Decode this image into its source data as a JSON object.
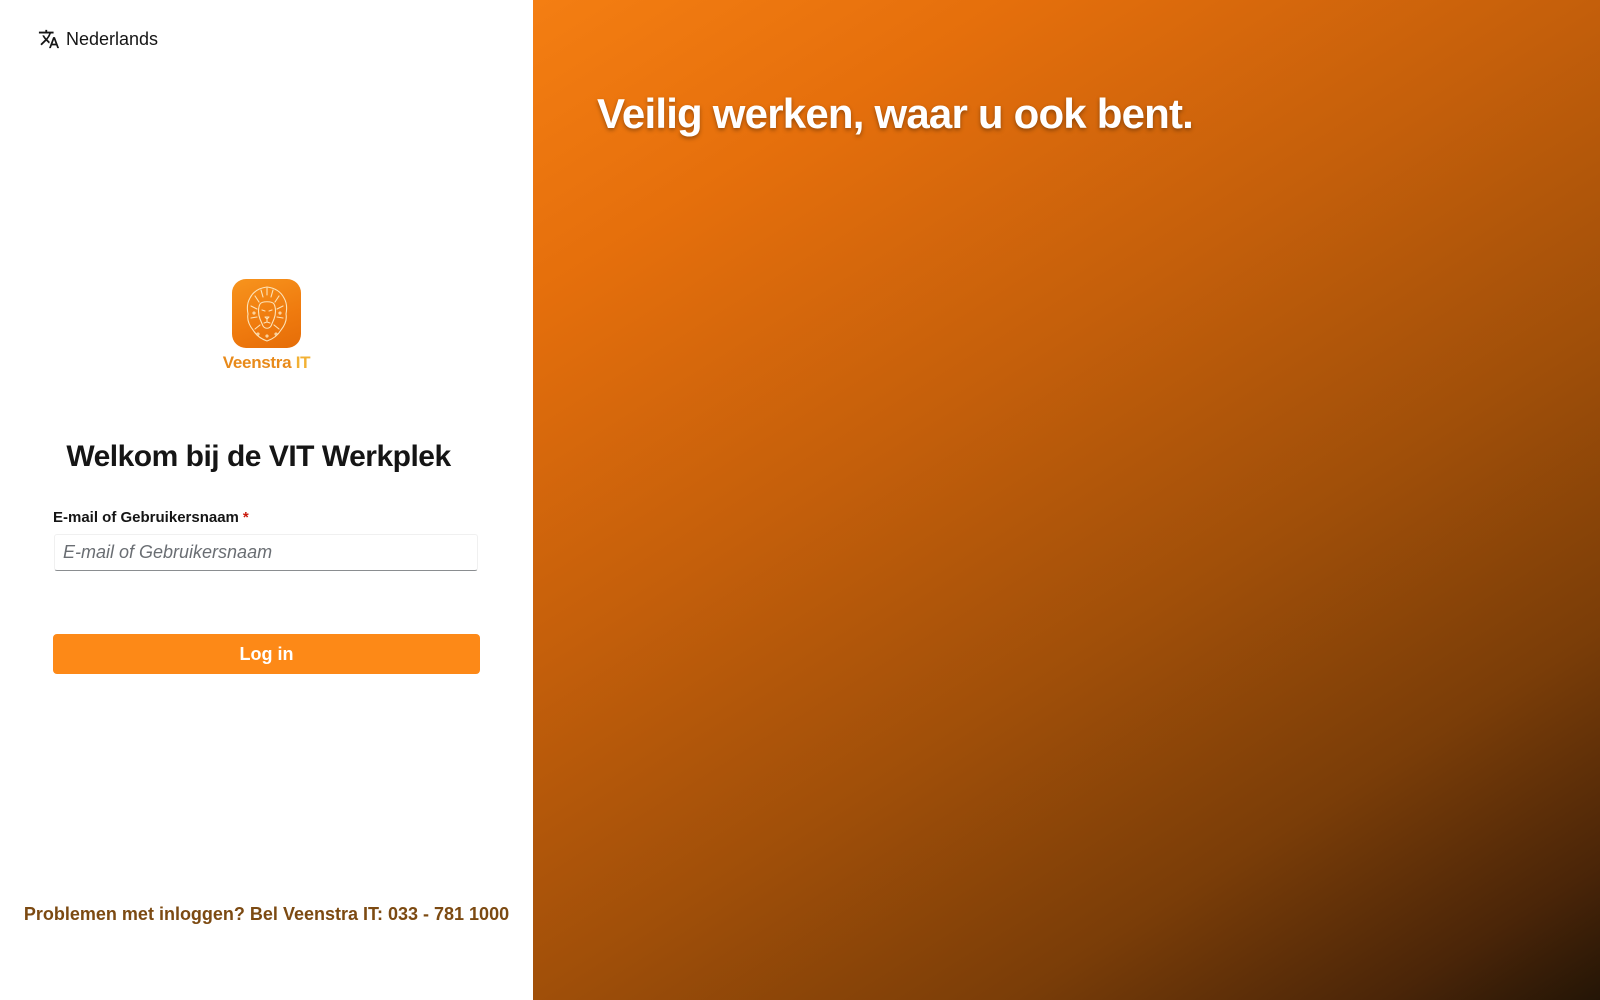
{
  "language": {
    "icon": "translate-icon",
    "label": "Nederlands"
  },
  "brand": {
    "logo_icon": "lion-icon",
    "name_main": "Veenstra",
    "name_suffix": "IT",
    "colors": {
      "tile": "#ef7a0e",
      "wordmark": "#e88a1a",
      "wordmark_suffix": "#f2b134"
    }
  },
  "login": {
    "title": "Welkom bij de VIT Werkplek",
    "field_label": "E-mail of Gebruikersnaam",
    "required_marker": "*",
    "field_value": "",
    "field_placeholder": "E-mail of Gebruikersnaam",
    "submit_label": "Log in"
  },
  "help": {
    "text": "Problemen met inloggen? Bel Veenstra IT: 033 - 781 1000"
  },
  "hero": {
    "tagline": "Veilig werken, waar u ook bent."
  },
  "colors": {
    "accent": "#fd8917",
    "help_text": "#7c4a12",
    "required": "#c9190b",
    "hero_gradient_start": "#f47e12",
    "hero_gradient_end": "#241506"
  }
}
